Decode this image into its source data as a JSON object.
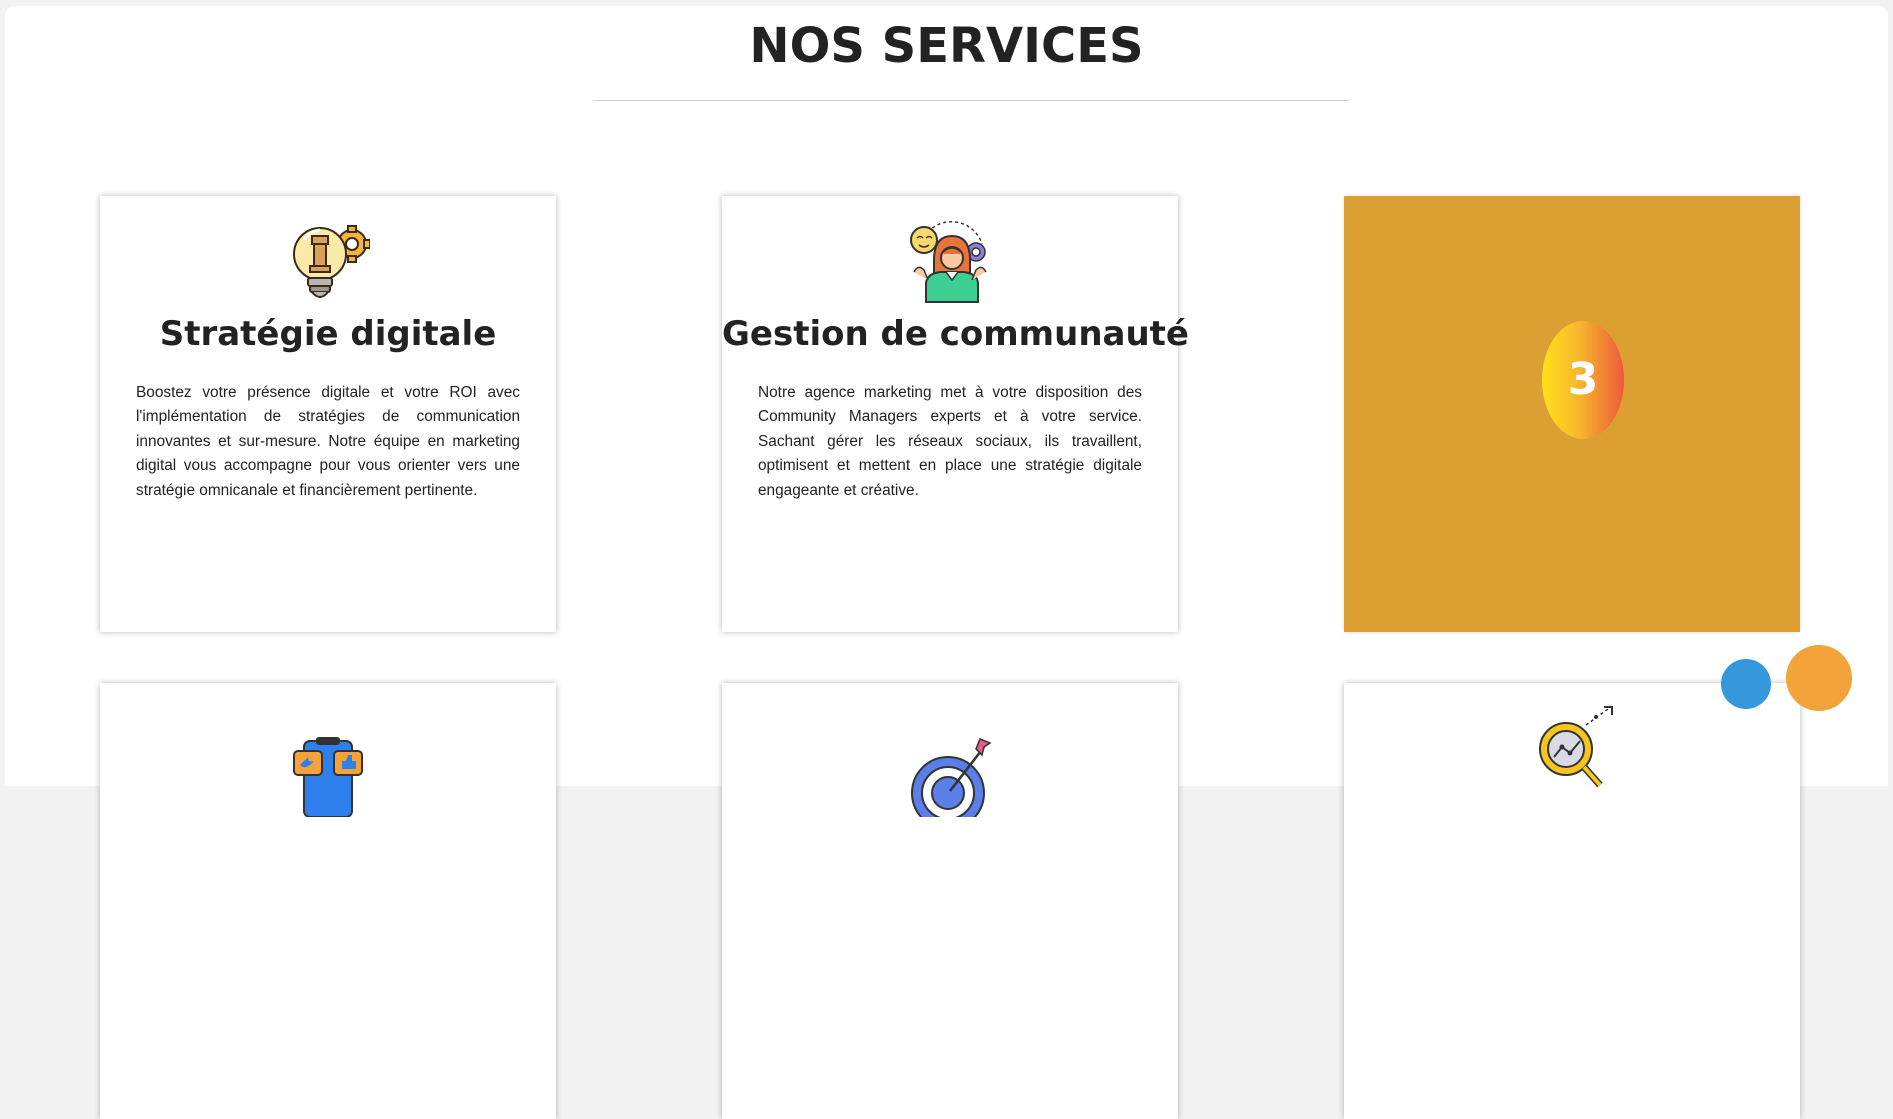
{
  "section": {
    "title": "NOS SERVICES"
  },
  "cards": [
    {
      "title": "Stratégie digitale",
      "icon": "lightbulb-chess-gear-icon",
      "text": "Boostez votre présence digitale et votre ROI avec l'implémentation de stratégies de communication innovantes et sur-mesure. Notre équipe en marketing digital vous accompagne pour vous orienter vers une stratégie omnicanale et financièrement pertinente."
    },
    {
      "title": "Gestion de communauté",
      "icon": "community-manager-icon",
      "text": "Notre agence marketing met à votre disposition des Community Managers experts et à votre service. Sachant gérer les réseaux sociaux, ils travaillent, optimisent et mettent en place une stratégie digitale engageante et créative."
    },
    {
      "number": "3",
      "background": "#dc9f33"
    },
    {
      "icon": "social-media-phone-icon"
    },
    {
      "icon": "target-arrow-icon"
    },
    {
      "icon": "magnifier-analytics-icon"
    }
  ],
  "colors": {
    "accent_orange": "#dc9f33",
    "dot_blue": "#3498db",
    "dot_orange": "#f2a33a"
  }
}
